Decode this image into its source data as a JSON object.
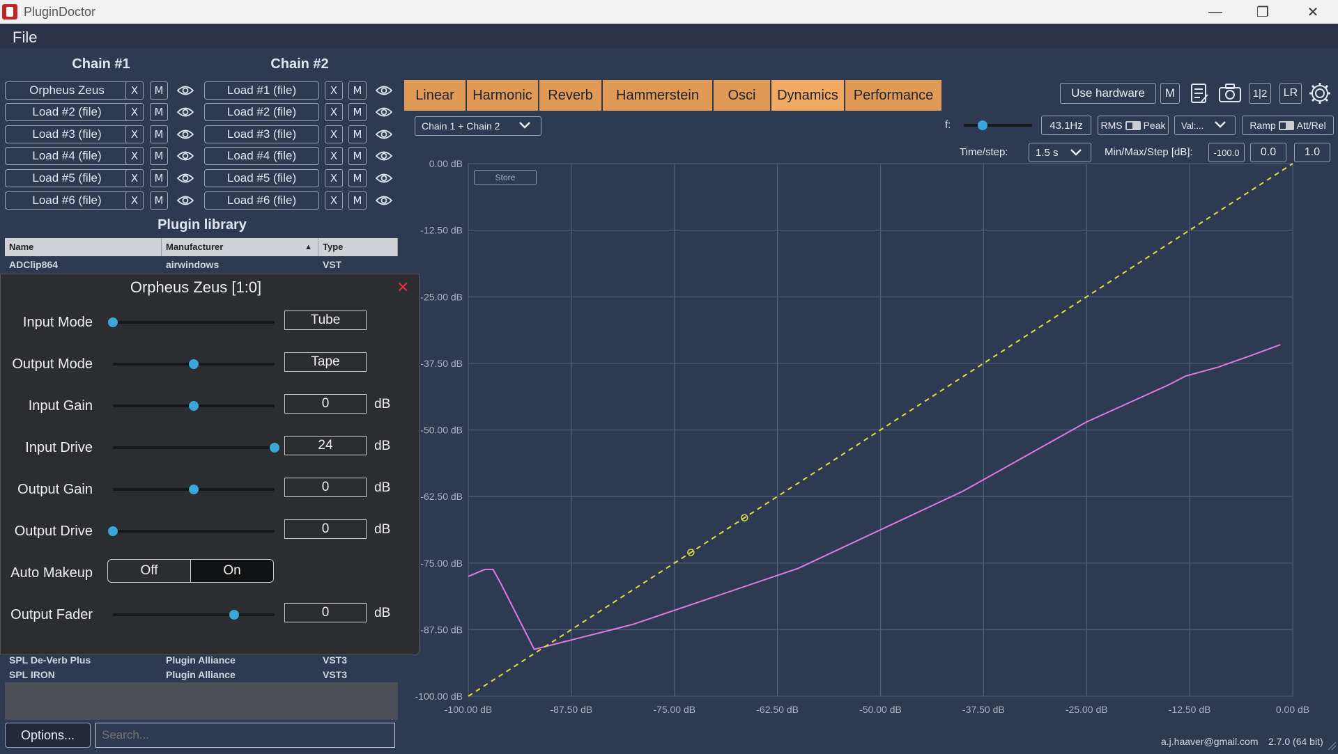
{
  "window": {
    "title": "PluginDoctor"
  },
  "menu": {
    "file": "File"
  },
  "chains": {
    "chain1": {
      "title": "Chain #1",
      "slots": [
        "Orpheus Zeus",
        "Load #2 (file)",
        "Load #3 (file)",
        "Load #4 (file)",
        "Load #5 (file)",
        "Load #6 (file)"
      ]
    },
    "chain2": {
      "title": "Chain #2",
      "slots": [
        "Load #1 (file)",
        "Load #2 (file)",
        "Load #3 (file)",
        "Load #4 (file)",
        "Load #5 (file)",
        "Load #6 (file)"
      ]
    },
    "remove_label": "X",
    "mute_label": "M"
  },
  "library": {
    "title": "Plugin library",
    "columns": [
      "Name",
      "Manufacturer",
      "Type"
    ],
    "sort_indicator": "▲",
    "rows_top": [
      {
        "name": "ADClip864",
        "manufacturer": "airwindows",
        "type": "VST"
      }
    ],
    "rows_bottom": [
      {
        "name": "SPL De-Verb Plus",
        "manufacturer": "Plugin Alliance",
        "type": "VST3"
      },
      {
        "name": "SPL IRON",
        "manufacturer": "Plugin Alliance",
        "type": "VST3"
      }
    ],
    "options_label": "Options...",
    "search_placeholder": "Search..."
  },
  "plugin_panel": {
    "title": "Orpheus Zeus [1:0]",
    "close": "✕",
    "params": [
      {
        "label": "Input Mode",
        "value": "Tube",
        "unit": "",
        "pos": 0.0
      },
      {
        "label": "Output Mode",
        "value": "Tape",
        "unit": "",
        "pos": 0.5
      },
      {
        "label": "Input Gain",
        "value": "0",
        "unit": "dB",
        "pos": 0.5
      },
      {
        "label": "Input Drive",
        "value": "24",
        "unit": "dB",
        "pos": 1.0
      },
      {
        "label": "Output Gain",
        "value": "0",
        "unit": "dB",
        "pos": 0.5
      },
      {
        "label": "Output Drive",
        "value": "0",
        "unit": "dB",
        "pos": 0.0
      }
    ],
    "auto_makeup": {
      "label": "Auto Makeup",
      "off": "Off",
      "on": "On",
      "selected": "On"
    },
    "output_fader": {
      "label": "Output Fader",
      "value": "0",
      "unit": "dB",
      "pos": 0.75
    }
  },
  "tabs": [
    "Linear",
    "Harmonic",
    "Reverb",
    "Hammerstein",
    "Osci",
    "Dynamics",
    "Performance"
  ],
  "active_tab": "Dynamics",
  "toolbar": {
    "use_hardware": "Use hardware",
    "mute": "M",
    "half": "1|2",
    "lr": "LR"
  },
  "controls": {
    "chain_select": "Chain 1 + Chain 2",
    "f_label": "f:",
    "f_value": "43.1Hz",
    "f_pos": 0.28,
    "rms": "RMS",
    "peak": "Peak",
    "val_select": "Val:...",
    "ramp": "Ramp",
    "att_rel": "Att/Rel",
    "time_step_label": "Time/step:",
    "time_step_value": "1.5 s",
    "minmax_label": "Min/Max/Step [dB]:",
    "min": "-100.0",
    "max": "0.0",
    "step": "1.0",
    "store": "Store"
  },
  "chart_data": {
    "type": "line",
    "xlim": [
      -100,
      0
    ],
    "ylim": [
      -100,
      0
    ],
    "x_ticks": [
      "-100.00 dB",
      "-87.50 dB",
      "-75.00 dB",
      "-62.50 dB",
      "-50.00 dB",
      "-37.50 dB",
      "-25.00 dB",
      "-12.50 dB",
      "0.00 dB"
    ],
    "y_ticks": [
      "0.00 dB",
      "-12.50 dB",
      "-25.00 dB",
      "-37.50 dB",
      "-50.00 dB",
      "-62.50 dB",
      "-75.00 dB",
      "-87.50 dB",
      "-100.00 dB"
    ],
    "series": [
      {
        "color": "#e07ae0",
        "style": "solid",
        "x": [
          -100,
          -98,
          -97,
          -96,
          -92,
          -80,
          -60,
          -40,
          -25,
          -15,
          -13,
          -9,
          -5,
          -1.5
        ],
        "y": [
          -77.5,
          -76.2,
          -76.2,
          -79,
          -91.2,
          -86.5,
          -76,
          -61.5,
          -48.5,
          -41.5,
          -39.9,
          -38.2,
          -36.0,
          -34.0
        ]
      },
      {
        "color": "#e2e23a",
        "style": "dashed",
        "x": [
          -100,
          0
        ],
        "y": [
          -100,
          0
        ]
      }
    ],
    "markers": [
      {
        "x": -73,
        "y": -73
      },
      {
        "x": -66.5,
        "y": -66.5
      }
    ],
    "grid": true
  },
  "footer": {
    "email": "a.j.haaver@gmail.com",
    "version": "2.7.0 (64 bit)"
  },
  "colors": {
    "background": "#2d3a52",
    "tab": "#e09a55",
    "accent": "#3ba6d8",
    "plot_line": "#e07ae0",
    "reference": "#e2e23a"
  }
}
